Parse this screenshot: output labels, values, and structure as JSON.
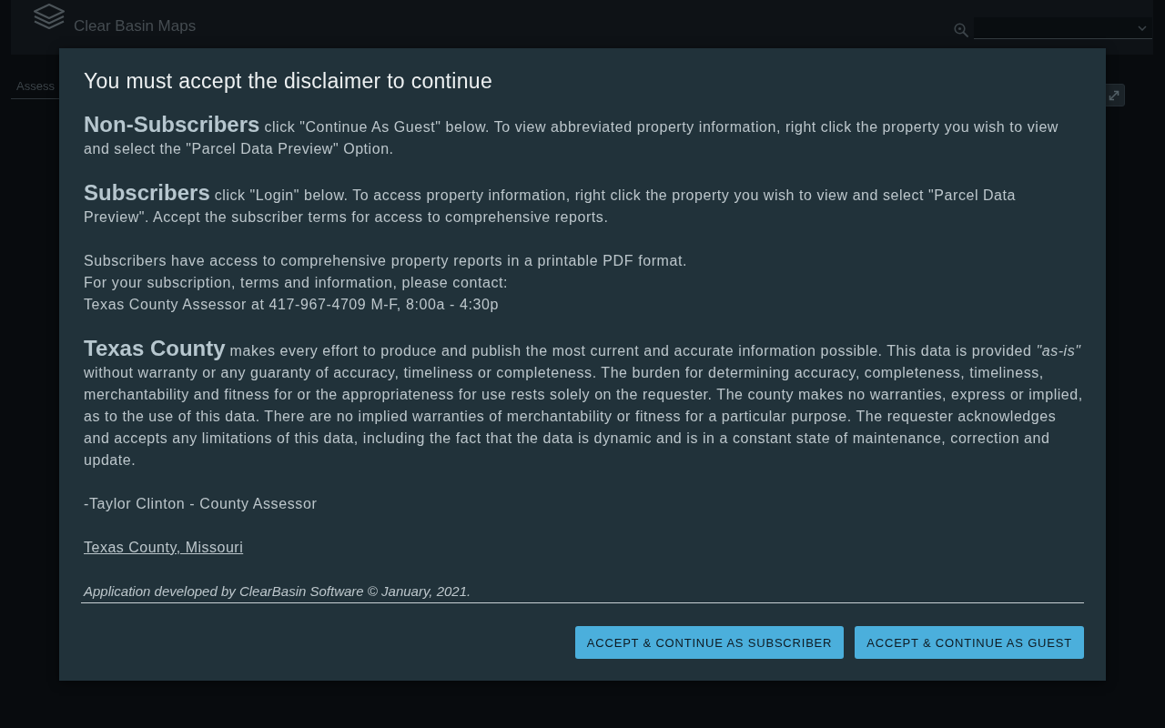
{
  "header": {
    "app_title": "Clear Basin Maps"
  },
  "panel_tab": {
    "label": "Assess"
  },
  "disclaimer": {
    "title": "You must accept the disclaimer to continue",
    "blocks": [
      {
        "kind": "lead",
        "lead": "Non-Subscribers",
        "text": "click \"Continue As Guest\" below. To view abbreviated property information, right click the property you wish to view and select the \"Parcel Data Preview\" Option."
      },
      {
        "kind": "lead",
        "lead": "Subscribers",
        "text": "click \"Login\" below. To access property information, right click the property you wish to view and select \"Parcel Data Preview\". Accept the subscriber terms for access to comprehensive reports."
      },
      {
        "kind": "lines",
        "lines": [
          "Subscribers have access to comprehensive property reports in a printable PDF format.",
          "For your subscription, terms and information, please contact:",
          "Texas County Assessor at 417-967-4709 M-F, 8:00a - 4:30p"
        ]
      },
      {
        "kind": "lead",
        "lead": "Texas County",
        "text": "makes every effort to produce and publish the most current and accurate information possible. This data is provided *\"as-is\"* without warranty or any guaranty of accuracy, timeliness or completeness. The burden for determining accuracy, completeness, timeliness, merchantability and fitness for or the appropriateness for use rests solely on the requester. The county makes no warranties, express or implied, as to the use of this data. There are no implied warranties of merchantability or fitness for a particular purpose. The requester acknowledges and accepts any limitations of this data, including the fact that the data is dynamic and is in a constant state of maintenance, correction and update."
      },
      {
        "kind": "text",
        "text": "-Taylor Clinton - County Assessor"
      },
      {
        "kind": "link",
        "text": "Texas County, Missouri"
      },
      {
        "kind": "credit",
        "text": "Application developed by ClearBasin Software © January, 2021."
      }
    ],
    "buttons": [
      "ACCEPT & CONTINUE AS SUBSCRIBER",
      "ACCEPT & CONTINUE AS GUEST"
    ]
  }
}
